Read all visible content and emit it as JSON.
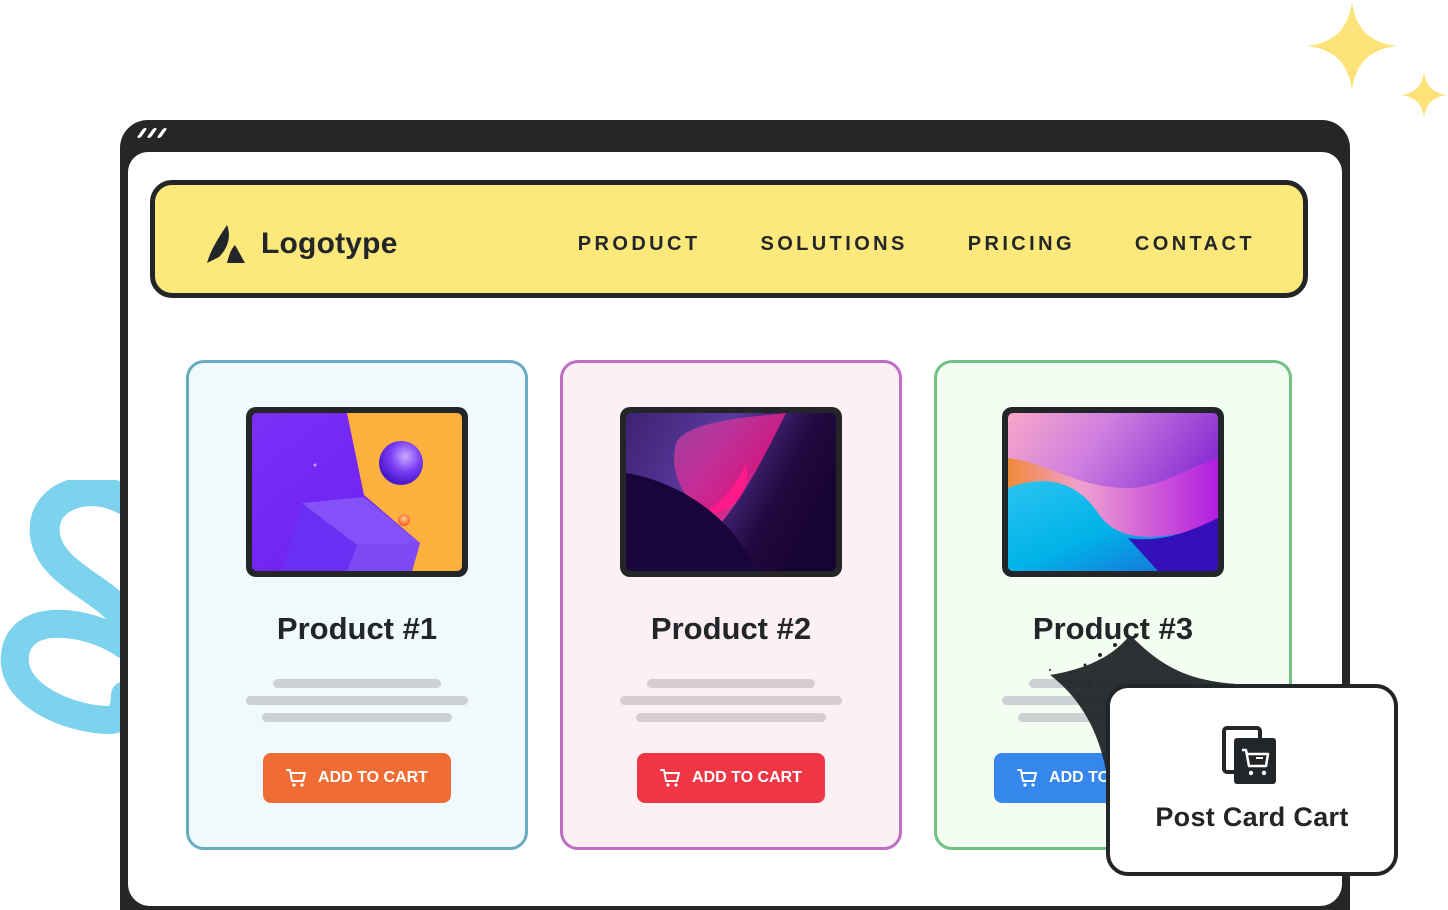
{
  "header": {
    "logo_text": "Logotype",
    "nav": [
      {
        "label": "PRODUCT"
      },
      {
        "label": "SOLUTIONS"
      },
      {
        "label": "PRICING"
      },
      {
        "label": "CONTACT"
      }
    ]
  },
  "products": [
    {
      "title": "Product #1",
      "button_label": "ADD TO CART",
      "button_color": "#ef6c35",
      "accent_border": "#68adbf"
    },
    {
      "title": "Product #2",
      "button_label": "ADD TO CART",
      "button_color": "#ef3645",
      "accent_border": "#c06ec4"
    },
    {
      "title": "Product #3",
      "button_label": "ADD TO CART",
      "button_color": "#3587ec",
      "accent_border": "#6fc284"
    }
  ],
  "popover": {
    "title": "Post Card Cart",
    "icon": "cart-cards-icon"
  },
  "colors": {
    "nav_background": "#fde87c",
    "frame": "#262626",
    "text": "#232629",
    "sparkle": "#fde27a",
    "squiggle": "#7dd2ee"
  }
}
